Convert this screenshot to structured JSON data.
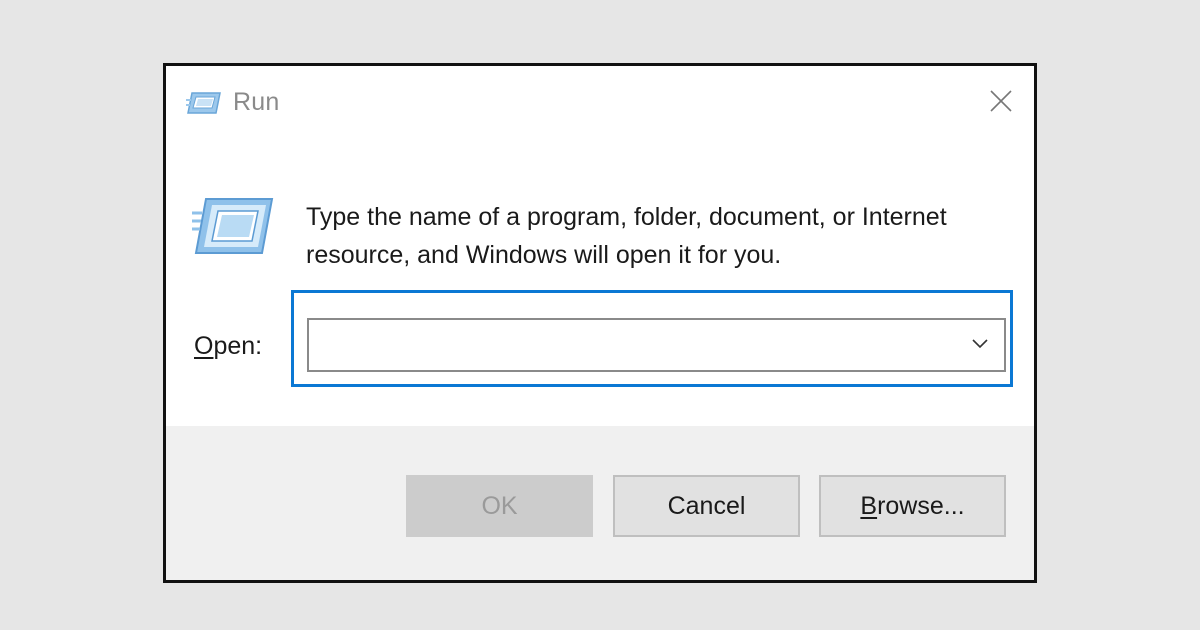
{
  "window": {
    "title": "Run",
    "title_icon": "run-icon",
    "close_icon": "close-icon"
  },
  "content": {
    "description": "Type the name of a program, folder, document, or Internet resource, and Windows will open it for you.",
    "open_label_mnemonic": "O",
    "open_label_rest": "pen:",
    "open_input_value": "",
    "dropdown_icon": "chevron-down-icon"
  },
  "buttons": {
    "ok_label": "OK",
    "cancel_label": "Cancel",
    "browse_mnemonic": "B",
    "browse_rest": "rowse..."
  },
  "colors": {
    "focus_accent": "#0b78d4",
    "footer_bg": "#f0f0f0",
    "disabled_button": "#cccccc"
  }
}
